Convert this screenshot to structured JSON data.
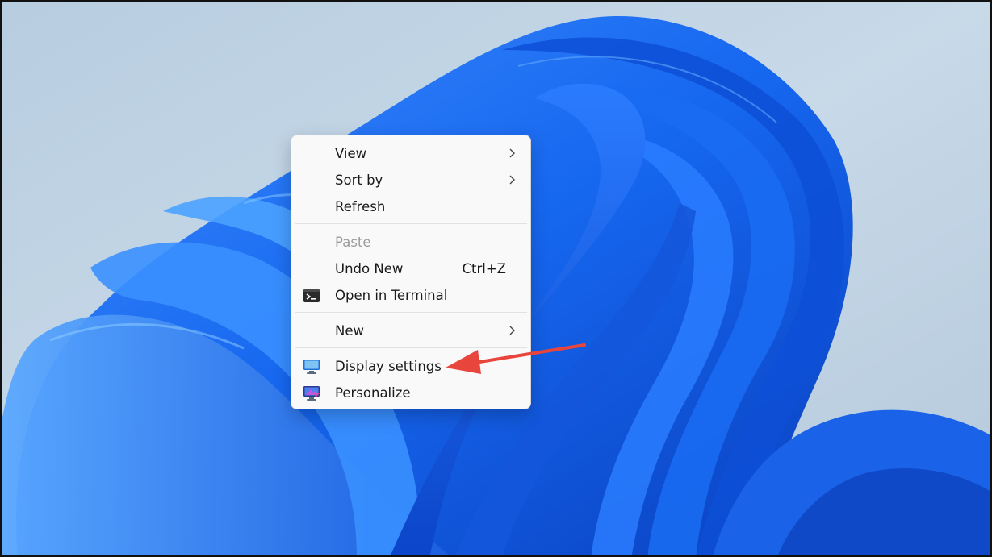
{
  "context_menu": {
    "items": [
      {
        "label": "View",
        "has_submenu": true,
        "enabled": true
      },
      {
        "label": "Sort by",
        "has_submenu": true,
        "enabled": true
      },
      {
        "label": "Refresh",
        "has_submenu": false,
        "enabled": true
      },
      {
        "label": "Paste",
        "has_submenu": false,
        "enabled": false
      },
      {
        "label": "Undo New",
        "shortcut": "Ctrl+Z",
        "enabled": true
      },
      {
        "label": "Open in Terminal",
        "icon": "terminal-icon",
        "enabled": true
      },
      {
        "label": "New",
        "has_submenu": true,
        "enabled": true
      },
      {
        "label": "Display settings",
        "icon": "monitor-icon",
        "enabled": true
      },
      {
        "label": "Personalize",
        "icon": "personalize-icon",
        "enabled": true
      }
    ]
  },
  "annotation": {
    "type": "arrow",
    "color": "#e8453c",
    "points_to": "Display settings"
  },
  "colors": {
    "menu_background": "#f9f9f9",
    "wallpaper_blue": "#1565e8",
    "wallpaper_sky": "#c3d5e6"
  }
}
